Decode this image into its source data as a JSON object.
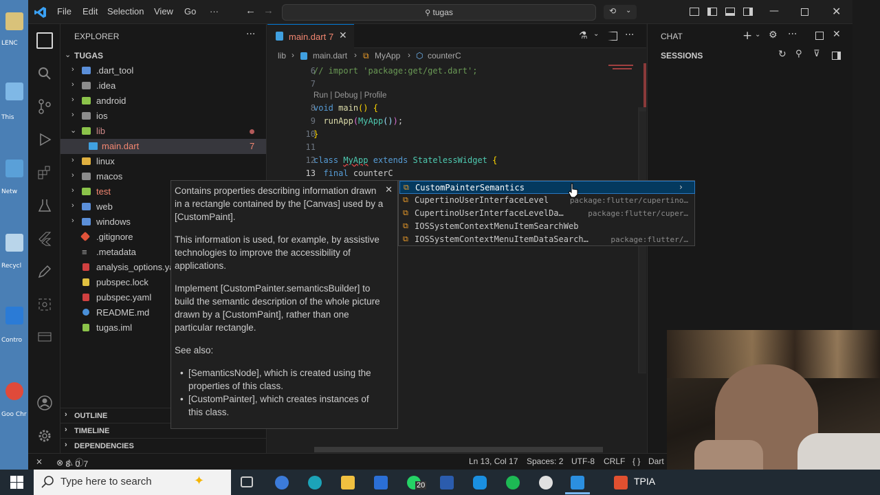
{
  "titlebar": {
    "menus": [
      "File",
      "Edit",
      "Selection",
      "View",
      "Go",
      "···"
    ],
    "search_text": "tugas"
  },
  "explorer": {
    "title": "EXPLORER",
    "root": "TUGAS",
    "items": [
      {
        "label": ".dart_tool",
        "kind": "folder"
      },
      {
        "label": ".idea",
        "kind": "folder"
      },
      {
        "label": "android",
        "kind": "folder"
      },
      {
        "label": "ios",
        "kind": "folder"
      },
      {
        "label": "lib",
        "kind": "folder-open"
      },
      {
        "label": "main.dart",
        "kind": "file-dart",
        "badge": "7"
      },
      {
        "label": "linux",
        "kind": "folder"
      },
      {
        "label": "macos",
        "kind": "folder"
      },
      {
        "label": "test",
        "kind": "folder"
      },
      {
        "label": "web",
        "kind": "folder"
      },
      {
        "label": "windows",
        "kind": "folder"
      },
      {
        "label": ".gitignore",
        "kind": "file"
      },
      {
        "label": ".metadata",
        "kind": "file"
      },
      {
        "label": "analysis_options.ya",
        "kind": "file"
      },
      {
        "label": "pubspec.lock",
        "kind": "file"
      },
      {
        "label": "pubspec.yaml",
        "kind": "file"
      },
      {
        "label": "README.md",
        "kind": "file"
      },
      {
        "label": "tugas.iml",
        "kind": "file"
      }
    ],
    "sections": [
      "OUTLINE",
      "TIMELINE",
      "DEPENDENCIES"
    ]
  },
  "editor": {
    "tab_label": "main.dart",
    "tab_badge": "7",
    "breadcrumbs": [
      "lib",
      "main.dart",
      "MyApp",
      "counterC"
    ],
    "codelens": "Run | Debug | Profile",
    "lines": [
      {
        "n": "6",
        "text": "// import 'package:get/get.dart';"
      },
      {
        "n": "7",
        "text": ""
      },
      {
        "n": "8",
        "text": "void main() {"
      },
      {
        "n": "9",
        "text": "  runApp(MyApp());"
      },
      {
        "n": "10",
        "text": "}"
      },
      {
        "n": "11",
        "text": ""
      },
      {
        "n": "12",
        "text": "class MyApp extends StatelessWidget {"
      },
      {
        "n": "13",
        "text": "  final counterC"
      }
    ]
  },
  "hover_doc": {
    "p1": "Contains properties describing information drawn in a rectangle contained by the [Canvas] used by a [CustomPaint].",
    "p2": "This information is used, for example, by assistive technologies to improve the accessibility of applications.",
    "p3": "Implement [CustomPainter.semanticsBuilder] to build the semantic description of the whole picture drawn by a [CustomPaint], rather than one particular rectangle.",
    "p4": "See also:",
    "li1": "[SemanticsNode], which is created using the properties of this class.",
    "li2": "[CustomPainter], which creates instances of this class."
  },
  "suggestions": [
    {
      "label": "CustomPainterSemantics",
      "detail": ""
    },
    {
      "label": "CupertinoUserInterfaceLevel",
      "detail": "package:flutter/cupertino…"
    },
    {
      "label": "CupertinoUserInterfaceLevelDa…",
      "detail": "package:flutter/cuper…"
    },
    {
      "label": "IOSSystemContextMenuItemSearchWeb",
      "detail": ""
    },
    {
      "label": "IOSSystemContextMenuItemDataSearch…",
      "detail": "package:flutter/…"
    }
  ],
  "chat": {
    "title": "CHAT",
    "sessions": "SESSIONS"
  },
  "statusbar": {
    "problems": "8",
    "warnings": "0",
    "info": "7",
    "position": "Ln 13, Col 17",
    "spaces": "Spaces: 2",
    "encoding": "UTF-8",
    "eol": "CRLF",
    "language": "Dart"
  },
  "desktop_labels": [
    "LENC",
    "This",
    "Netw",
    "Recycl",
    "Contro",
    "Goo Chr"
  ],
  "taskbar": {
    "search_placeholder": "Type here to search",
    "whatsapp_badge": "20",
    "tray_text": "TPIA"
  }
}
